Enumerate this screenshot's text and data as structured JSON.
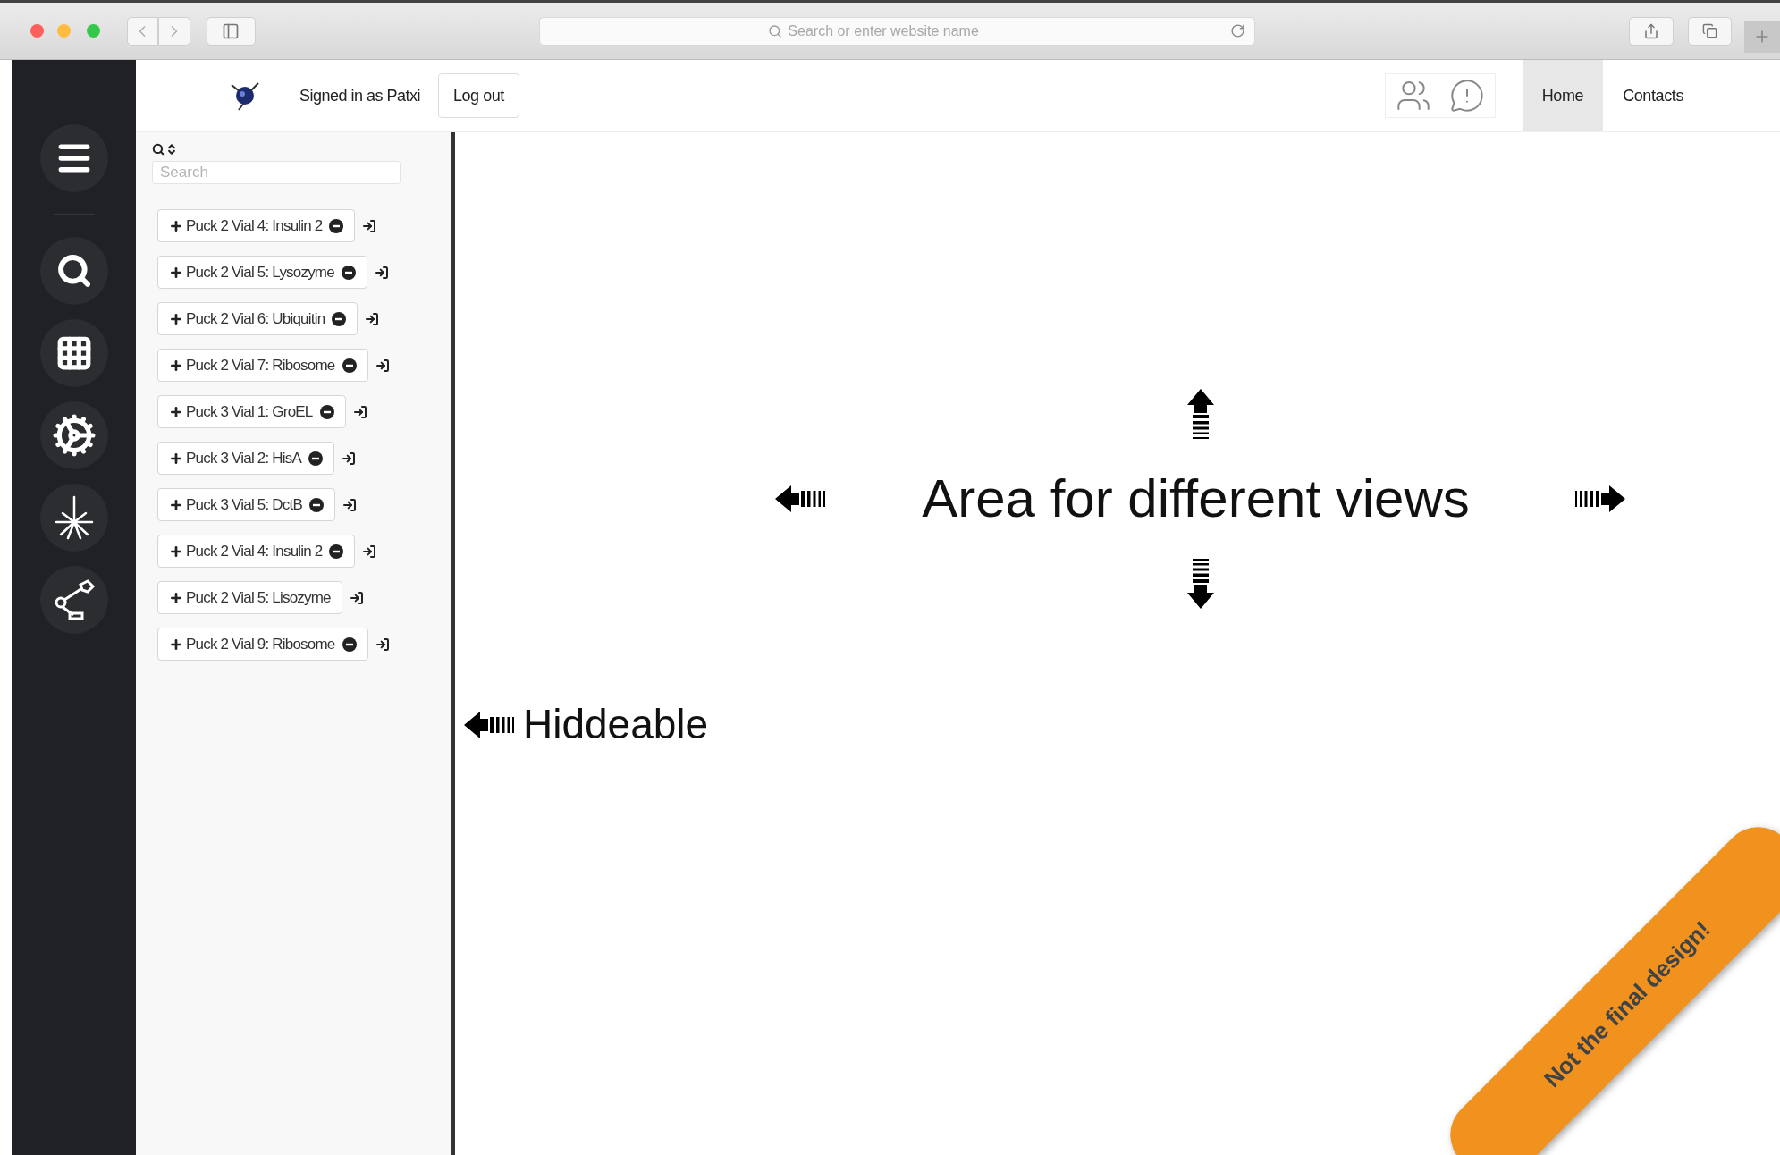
{
  "browser": {
    "address_placeholder": "Search or enter website name"
  },
  "header": {
    "signed_in": "Signed in as Patxi",
    "logout": "Log out",
    "nav": [
      {
        "label": "Home",
        "selected": true
      },
      {
        "label": "Contacts",
        "selected": false
      }
    ]
  },
  "sample_panel": {
    "search_placeholder": "Search",
    "items": [
      {
        "label": "Puck 2 Vial 4: Insulin 2",
        "removable": true
      },
      {
        "label": "Puck 2 Vial 5: Lysozyme",
        "removable": true
      },
      {
        "label": "Puck 2 Vial 6: Ubiquitin",
        "removable": true
      },
      {
        "label": "Puck 2 Vial 7: Ribosome",
        "removable": true
      },
      {
        "label": "Puck 3 Vial 1: GroEL",
        "removable": true
      },
      {
        "label": "Puck 3 Vial 2: HisA",
        "removable": true
      },
      {
        "label": "Puck 3 Vial 5: DctB",
        "removable": true
      },
      {
        "label": "Puck 2 Vial 4: Insulin 2",
        "removable": true
      },
      {
        "label": "Puck 2 Vial 5: Lisozyme",
        "removable": false
      },
      {
        "label": "Puck 2 Vial 9: Ribosome",
        "removable": true
      }
    ]
  },
  "main": {
    "title": "Area for different views",
    "annotation": "Hiddeable"
  },
  "ribbon": {
    "text": "Not the final design!"
  }
}
